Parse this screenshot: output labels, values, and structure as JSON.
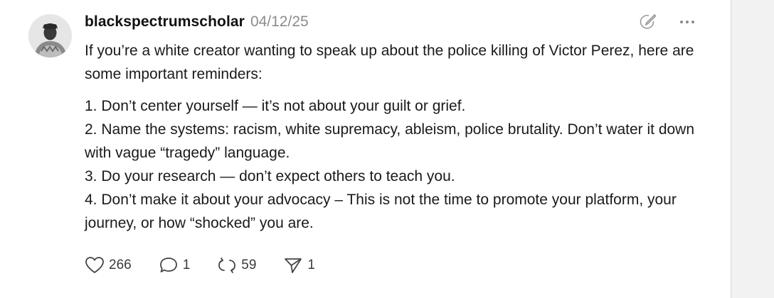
{
  "post": {
    "username": "blackspectrumscholar",
    "date": "04/12/25",
    "body": {
      "intro": "If you’re a white creator wanting to speak up about the police killing of Victor Perez, here are some important reminders:",
      "items": [
        "1. Don’t center yourself — it’s not about your guilt or grief.",
        "2. Name the systems: racism, white supremacy, ableism, police brutality. Don’t water it down with vague “tragedy” language.",
        "3. Do your research — don’t expect others to teach you.",
        "4. Don’t make it about your advocacy – This is not the time to promote your platform, your journey, or how “shocked” you are."
      ]
    },
    "actions": {
      "likes": "266",
      "comments": "1",
      "restacks": "59",
      "shares": "1"
    }
  },
  "icons": {
    "top": [
      "edit-icon",
      "more-icon"
    ],
    "actions": [
      "heart-icon",
      "comment-icon",
      "restack-icon",
      "share-icon"
    ]
  },
  "colors": {
    "date": "#8c8c8c",
    "text": "#1a1a1a",
    "icons": "#444444"
  }
}
